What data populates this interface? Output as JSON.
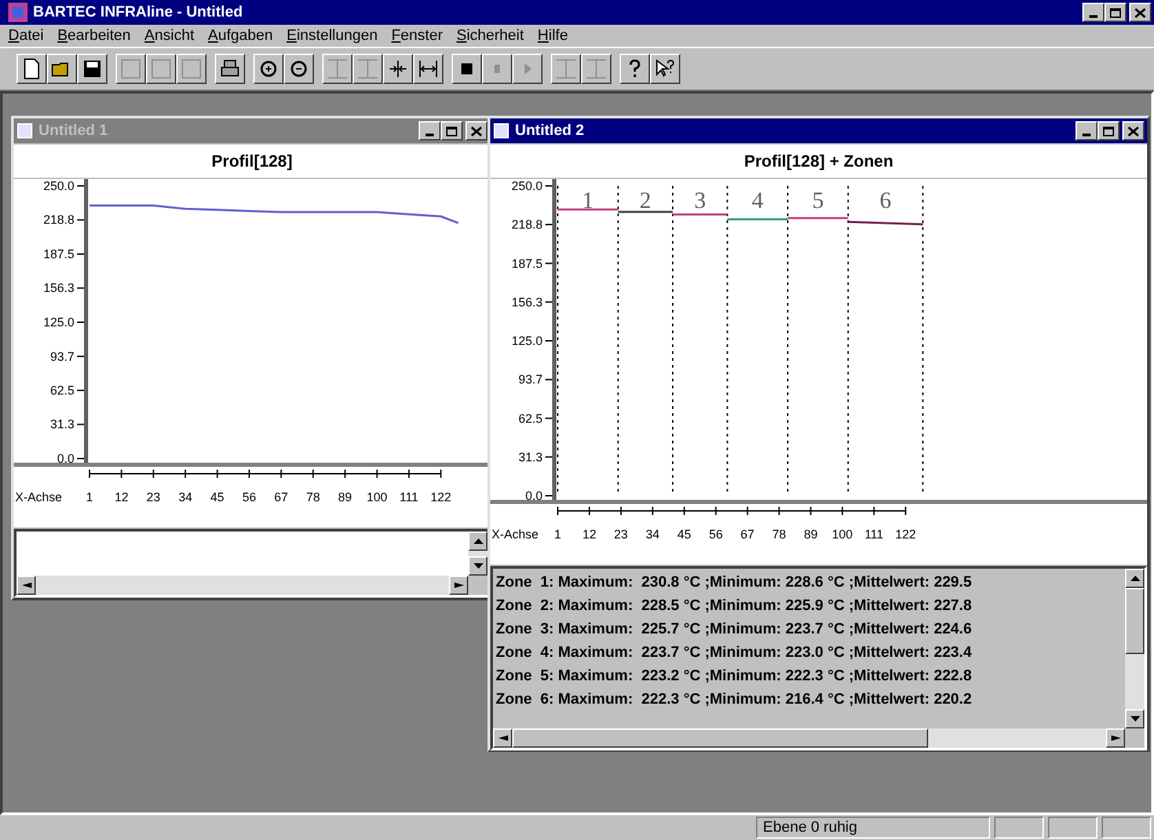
{
  "window": {
    "title": "BARTEC INFRAline - Untitled"
  },
  "menu": [
    {
      "label": "Datei"
    },
    {
      "label": "Bearbeiten"
    },
    {
      "label": "Ansicht"
    },
    {
      "label": "Aufgaben"
    },
    {
      "label": "Einstellungen"
    },
    {
      "label": "Fenster"
    },
    {
      "label": "Sicherheit"
    },
    {
      "label": "Hilfe"
    }
  ],
  "toolbar": [
    [
      {
        "kind": "new",
        "disabled": false
      },
      {
        "kind": "open",
        "disabled": false
      },
      {
        "kind": "save",
        "disabled": false
      }
    ],
    [
      {
        "kind": "blank",
        "disabled": true
      },
      {
        "kind": "blank",
        "disabled": true
      },
      {
        "kind": "blank",
        "disabled": true
      }
    ],
    [
      {
        "kind": "print",
        "disabled": false
      }
    ],
    [
      {
        "kind": "zoom-in",
        "disabled": false
      },
      {
        "kind": "zoom-out",
        "disabled": false
      }
    ],
    [
      {
        "kind": "bar",
        "disabled": true
      },
      {
        "kind": "bar",
        "disabled": true
      },
      {
        "kind": "arrows-in",
        "disabled": false
      },
      {
        "kind": "arrows-out",
        "disabled": false
      }
    ],
    [
      {
        "kind": "stop",
        "disabled": false
      },
      {
        "kind": "pause",
        "disabled": true
      },
      {
        "kind": "play",
        "disabled": true
      }
    ],
    [
      {
        "kind": "bar",
        "disabled": true
      },
      {
        "kind": "bar",
        "disabled": true
      }
    ],
    [
      {
        "kind": "help",
        "disabled": false
      },
      {
        "kind": "context-help",
        "disabled": false
      }
    ]
  ],
  "documents": [
    {
      "title": "Untitled 1",
      "active": false,
      "heading": "Profil[128]",
      "chart_data": {
        "type": "line",
        "xlabel": "X-Achse",
        "x": [
          1,
          12,
          23,
          34,
          45,
          56,
          67,
          78,
          89,
          100,
          111,
          122,
          128
        ],
        "series": [
          {
            "color": "#6060d0",
            "values": [
              232,
              232,
              232,
              229,
              228,
              227,
              226,
              226,
              226,
              226,
              224,
              222,
              216
            ]
          }
        ],
        "xlim": [
          1,
          139
        ],
        "ylim": [
          0,
          250
        ],
        "xticks": [
          1,
          12,
          23,
          34,
          45,
          56,
          67,
          78,
          89,
          100,
          111,
          122
        ],
        "yticks": [
          {
            "value": 0,
            "label": "0.0"
          },
          31.3,
          62.5,
          93.7,
          {
            "value": 125,
            "label": "125.0"
          },
          156.3,
          187.5,
          218.8,
          {
            "value": 250,
            "label": "250.0"
          }
        ]
      }
    },
    {
      "title": "Untitled 2",
      "active": true,
      "heading": "Profil[128] + Zonen",
      "chart_data": {
        "type": "line",
        "xlabel": "X-Achse",
        "x": [
          1,
          22,
          41,
          60,
          81,
          102,
          128
        ],
        "series": [
          {
            "color": "#c04080",
            "values": [
              231,
              231,
              null,
              null,
              null,
              null,
              null
            ]
          },
          {
            "color": "#404040",
            "values": [
              null,
              229,
              229,
              null,
              null,
              null,
              null
            ]
          },
          {
            "color": "#c04080",
            "values": [
              null,
              null,
              227,
              227,
              null,
              null,
              null
            ]
          },
          {
            "color": "#30a080",
            "values": [
              null,
              null,
              null,
              223,
              223,
              null,
              null
            ]
          },
          {
            "color": "#c04080",
            "values": [
              null,
              null,
              null,
              null,
              224,
              224,
              null
            ]
          },
          {
            "color": "#702050",
            "values": [
              null,
              null,
              null,
              null,
              null,
              221,
              219
            ]
          }
        ],
        "annotations": [
          "1",
          "2",
          "3",
          "4",
          "5",
          "6"
        ],
        "xlim": [
          1,
          206
        ],
        "ylim": [
          0,
          250
        ],
        "xticks": [
          1,
          12,
          23,
          34,
          45,
          56,
          67,
          78,
          89,
          100,
          111,
          122
        ],
        "yticks": [
          {
            "value": 0,
            "label": "0.0"
          },
          31.3,
          62.5,
          93.7,
          {
            "value": 125,
            "label": "125.0"
          },
          156.3,
          187.5,
          218.8,
          {
            "value": 250,
            "label": "250.0"
          }
        ]
      },
      "list": [
        "Zone  1: Maximum:  230.8 °C ;Minimum: 228.6 °C ;Mittelwert: 229.5",
        "Zone  2: Maximum:  228.5 °C ;Minimum: 225.9 °C ;Mittelwert: 227.8",
        "Zone  3: Maximum:  225.7 °C ;Minimum: 223.7 °C ;Mittelwert: 224.6",
        "Zone  4: Maximum:  223.7 °C ;Minimum: 223.0 °C ;Mittelwert: 223.4",
        "Zone  5: Maximum:  223.2 °C ;Minimum: 222.3 °C ;Mittelwert: 222.8",
        "Zone  6: Maximum:  222.3 °C ;Minimum: 216.4 °C ;Mittelwert: 220.2"
      ]
    }
  ],
  "status_bar": {
    "text": "Ebene 0 ruhig"
  }
}
